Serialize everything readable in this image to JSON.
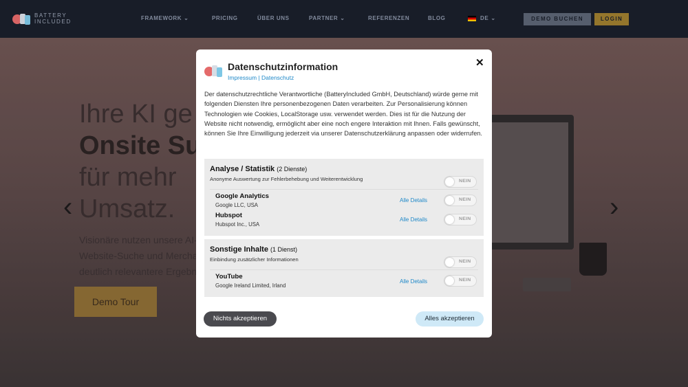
{
  "nav": {
    "logo_line1": "BATTERY",
    "logo_line2": "INCLUDED",
    "items": [
      {
        "label": "FRAMEWORK",
        "chevron": true
      },
      {
        "label": "PRICING",
        "chevron": false
      },
      {
        "label": "ÜBER UNS",
        "chevron": false
      },
      {
        "label": "PARTNER",
        "chevron": true
      },
      {
        "label": "REFERENZEN",
        "chevron": false
      },
      {
        "label": "BLOG",
        "chevron": false
      }
    ],
    "language": "DE",
    "demo_button": "DEMO BUCHEN",
    "login_button": "LOGIN",
    "chevron_glyph": "⌄"
  },
  "hero": {
    "line1": "Ihre KI ge",
    "line2": "Onsite Su",
    "line3": "für mehr",
    "line4": "Umsatz.",
    "sub1": "Visionäre nutzen unsere AI-",
    "sub2": "Website-Suche und Mercha",
    "sub3": "deutlich relevantere Ergebni",
    "cta": "Demo Tour",
    "prev_arrow": "‹",
    "next_arrow": "›"
  },
  "modal": {
    "title": "Datenschutzinformation",
    "link_impressum": "Impressum",
    "link_separator": " | ",
    "link_datenschutz": "Datenschutz",
    "close": "✕",
    "intro": "Der datenschutzrechtliche Verantwortliche (BatteryIncluded GmbH, Deutschland) würde gerne mit folgenden Diensten Ihre personenbezogenen Daten verarbeiten. Zur Personalisierung können Technologien wie Cookies, LocalStorage usw. verwendet werden. Dies ist für die Nutzung der Website nicht notwendig, ermöglicht aber eine noch engere Interaktion mit Ihnen. Falls gewünscht, können Sie Ihre Einwilligung jederzeit via unserer Datenschutzerklärung anpassen oder widerrufen.",
    "groups": [
      {
        "title": "Analyse / Statistik",
        "count": "(2 Dienste)",
        "description": "Anonyme Auswertung zur Fehlerbehebung und Weiterentwicklung",
        "toggle": "NEIN",
        "services": [
          {
            "name": "Google Analytics",
            "company": "Google LLC, USA",
            "details": "Alle Details",
            "toggle": "NEIN"
          },
          {
            "name": "Hubspot",
            "company": "Hubspot Inc., USA",
            "details": "Alle Details",
            "toggle": "NEIN"
          }
        ]
      },
      {
        "title": "Sonstige Inhalte",
        "count": "(1 Dienst)",
        "description": "Einbindung zusätzlicher Informationen",
        "toggle": "NEIN",
        "services": [
          {
            "name": "YouTube",
            "company": "Google Ireland Limited, Irland",
            "details": "Alle Details",
            "toggle": "NEIN"
          }
        ]
      }
    ],
    "reject_button": "Nichts akzeptieren",
    "accept_button": "Alles akzeptieren"
  },
  "colors": {
    "accent_link": "#1e88c8",
    "accept_button_bg": "#cfe9f7",
    "reject_button_bg": "#4a4a4f",
    "navbar_bg": "#1a1f2b"
  }
}
